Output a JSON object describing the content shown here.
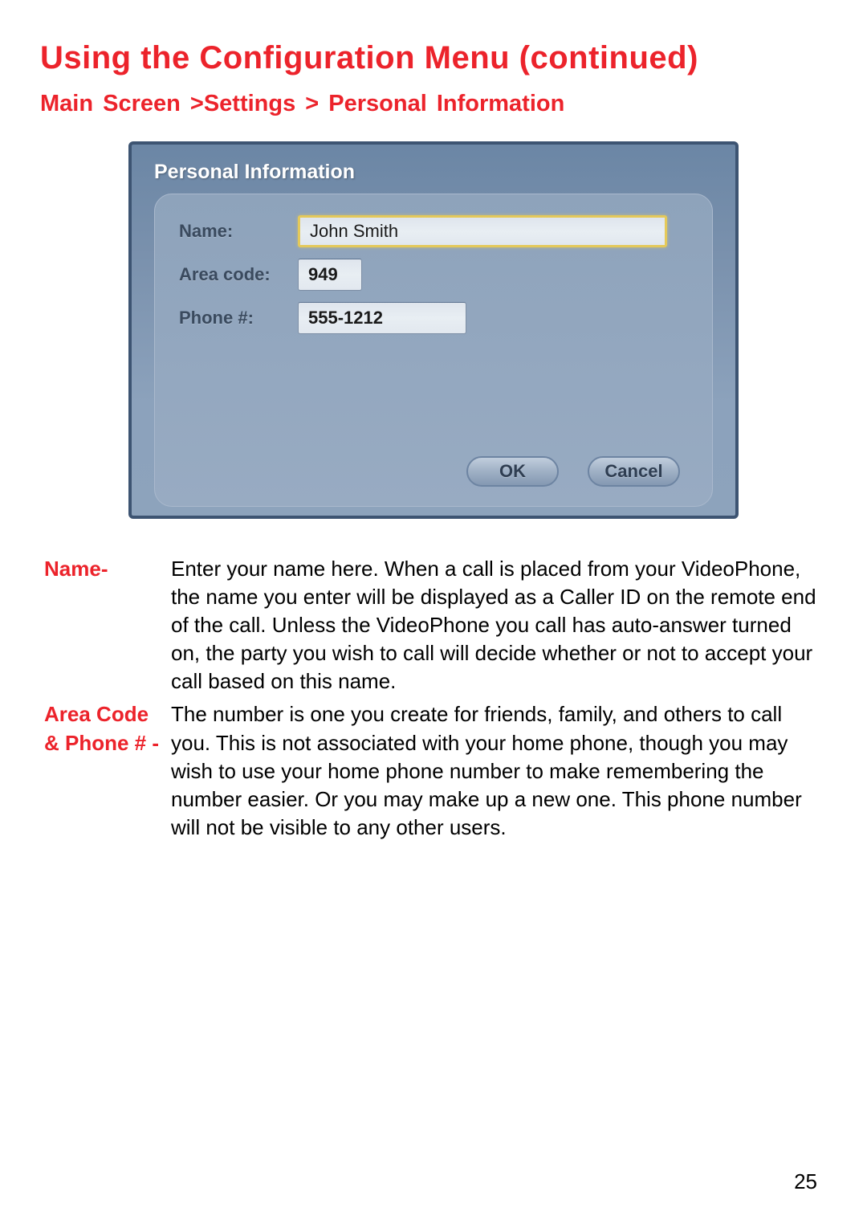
{
  "page": {
    "title": "Using the Configuration Menu (continued)",
    "breadcrumb": "Main Screen >Settings > Personal Information",
    "number": "25"
  },
  "dialog": {
    "title": "Personal Information",
    "fields": {
      "name_label": "Name:",
      "name_value": "John Smith",
      "area_label": "Area code:",
      "area_value": "949",
      "phone_label": "Phone #:",
      "phone_value": "555-1212"
    },
    "buttons": {
      "ok": "OK",
      "cancel": "Cancel"
    }
  },
  "descriptions": {
    "name_label": "Name-",
    "name_text": "Enter your name here. When a call is placed from your VideoPhone, the name you enter will be displayed as a Caller ID on the remote end of the call. Unless the VideoPhone you call has auto-answer turned on, the party you wish to call will decide whether or not to accept your call based on this name.",
    "area_label_line1": "Area Code",
    "area_label_line2": "& Phone # -",
    "area_text": "The number is one you create for friends, family, and others to call you. This is not associated with your home phone, though you may wish to use your home phone number to make remembering the number easier. Or you may make up a new one. This phone number will not be visible to any other users."
  }
}
